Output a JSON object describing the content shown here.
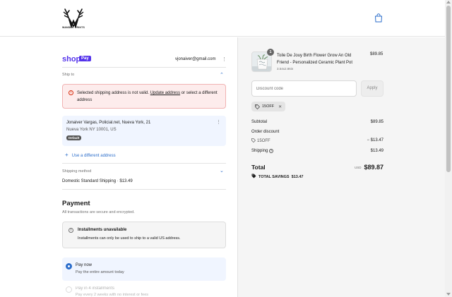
{
  "header": {
    "brand_text": "WANDER PRINTS",
    "cart_icon": "shopping-bag-icon"
  },
  "account": {
    "provider_word": "shop",
    "provider_badge": "Pay",
    "email": "vjonaiver@gmail.com",
    "menu_icon": "more-vertical-icon"
  },
  "ship_to": {
    "label": "Ship to",
    "error_prefix": "Selected shipping address is not valid. ",
    "error_link": "Update address",
    "error_suffix": " or select a different address",
    "address_line1": "Jonaiver Vargas, Policial.net, Nueva York, 21",
    "address_line2": "Nueva York NY 10001, US",
    "default_badge": "Default",
    "use_different": "Use a different address"
  },
  "shipping_method": {
    "label": "Shipping method",
    "value": "Domestic Standard Shipping · $13.49"
  },
  "payment": {
    "title": "Payment",
    "subtitle": "All transactions are secure and encrypted.",
    "installments_title": "Installments unavailable",
    "installments_text": "Installments can only be used to ship to a valid US address.",
    "pay_now_title": "Pay now",
    "pay_now_sub": "Pay the entire amount today",
    "pay4_title": "Pay in 4 installments",
    "pay4_sub": "Pay every 2 weeks with no interest or fees"
  },
  "order": {
    "quantity": "1",
    "product_title": "Toile De Jouy Birth Flower Grow An Old Friend - Personalized Ceramic Plant Pot",
    "product_variant": "3.54x2.86in",
    "product_price": "$89.85",
    "discount_placeholder": "Discount code",
    "apply_label": "Apply",
    "applied_code": "15OFF",
    "subtotal_label": "Subtotal",
    "subtotal_value": "$89.85",
    "order_discount_label": "Order discount",
    "discount_code_label": "15OFF",
    "discount_value": "− $13.47",
    "shipping_label": "Shipping",
    "shipping_value": "$13.49",
    "total_label": "Total",
    "currency": "USD",
    "total_value": "$89.87",
    "savings_label": "TOTAL SAVINGS",
    "savings_value": "$13.47"
  },
  "colors": {
    "shop_brand": "#5433eb",
    "link_blue": "#2c6ecb",
    "error_red": "#d72c0d"
  }
}
